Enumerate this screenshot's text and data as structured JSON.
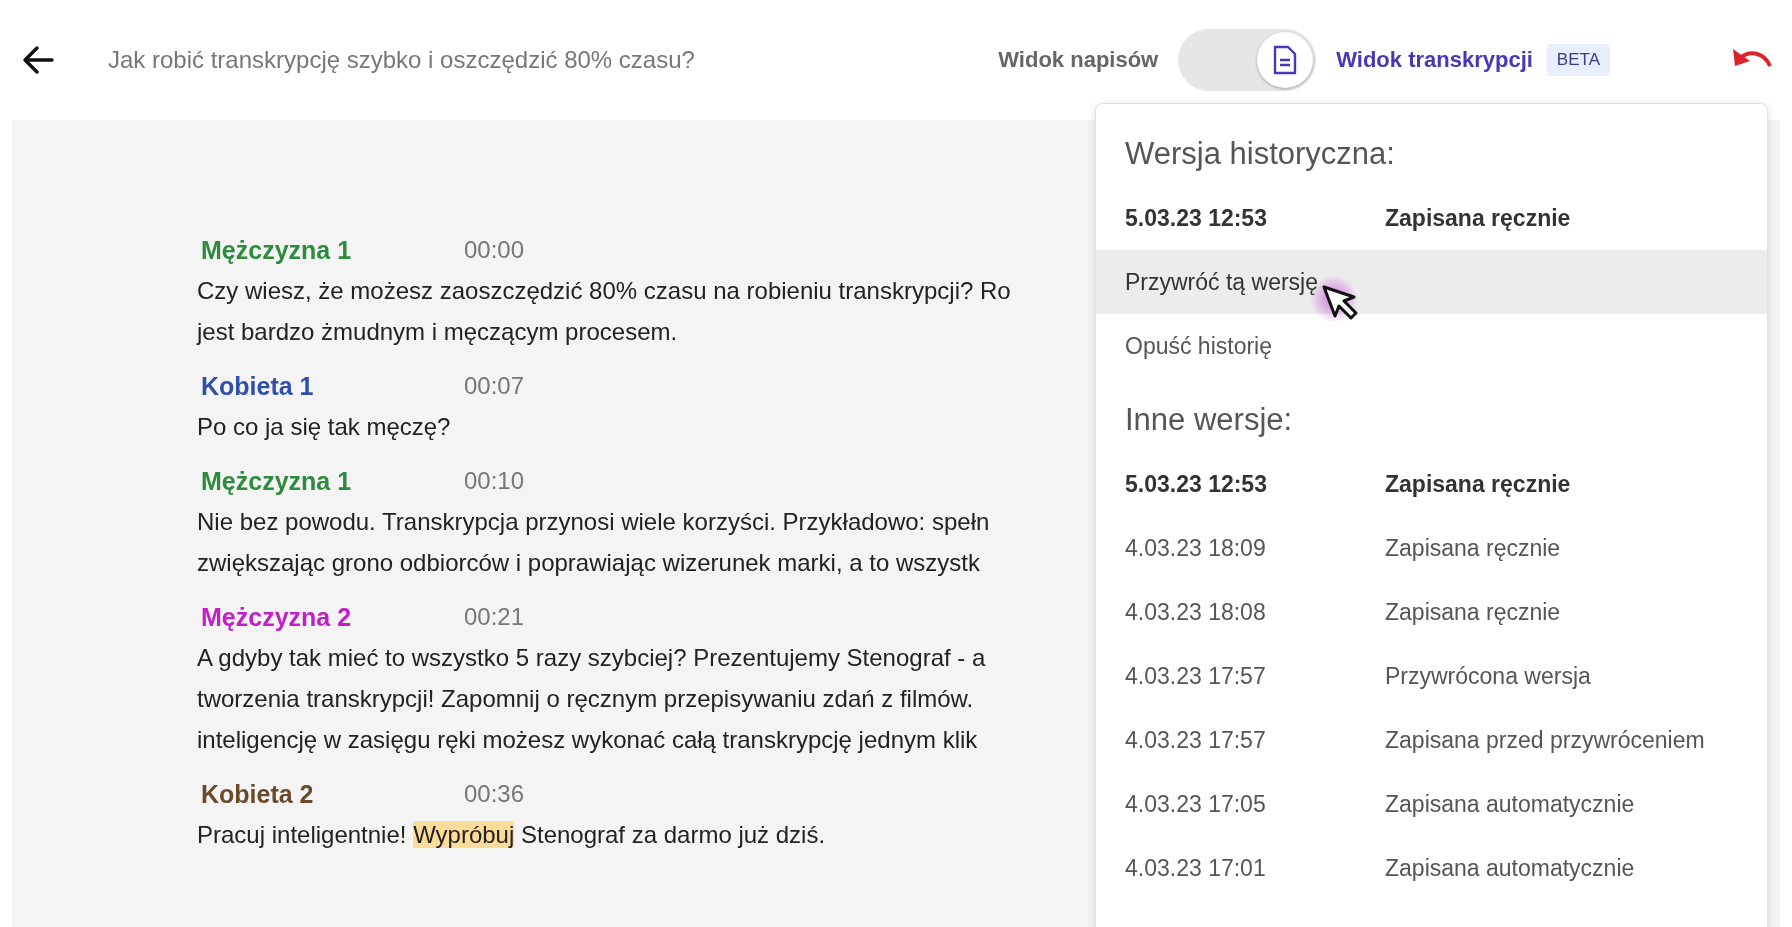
{
  "header": {
    "title": "Jak robić transkrypcję szybko i oszczędzić 80% czasu?",
    "view_toggle": {
      "left_label": "Widok napisów",
      "right_label": "Widok transkrypcji",
      "on": true,
      "badge": "BETA"
    }
  },
  "transcript": [
    {
      "speaker": "Mężczyzna 1",
      "color": "#2e8b3e",
      "time": "00:00",
      "lines": [
        [
          {
            "text": "Czy wiesz, że możesz zaoszczędzić 80% czasu na robieniu transkrypcji? Ro",
            "highlighted": false
          }
        ],
        [
          {
            "text": "jest bardzo żmudnym i męczącym procesem.",
            "highlighted": false
          }
        ]
      ]
    },
    {
      "speaker": "Kobieta 1",
      "color": "#2f4fa8",
      "time": "00:07",
      "lines": [
        [
          {
            "text": "Po co ja się tak męczę?",
            "highlighted": false
          }
        ]
      ]
    },
    {
      "speaker": "Mężczyzna 1",
      "color": "#2e8b3e",
      "time": "00:10",
      "lines": [
        [
          {
            "text": "Nie bez powodu. Transkrypcja przynosi wiele korzyści. Przykładowo: spełn",
            "highlighted": false
          }
        ],
        [
          {
            "text": "zwiększając grono odbiorców i poprawiając wizerunek marki, a to wszystk",
            "highlighted": false
          }
        ]
      ]
    },
    {
      "speaker": "Mężczyzna 2",
      "color": "#c21fc8",
      "time": "00:21",
      "lines": [
        [
          {
            "text": "A gdyby tak mieć to wszystko 5 razy szybciej? Prezentujemy Stenograf - a",
            "highlighted": false
          }
        ],
        [
          {
            "text": "tworzenia transkrypcji! Zapomnij o ręcznym przepisywaniu zdań z filmów.",
            "highlighted": false
          }
        ],
        [
          {
            "text": "inteligencję w zasięgu ręki możesz wykonać całą transkrypcję jednym klik",
            "highlighted": false
          }
        ]
      ]
    },
    {
      "speaker": "Kobieta 2",
      "color": "#6b4a2b",
      "time": "00:36",
      "lines": [
        [
          {
            "text": "Pracuj inteligentnie! ",
            "highlighted": false
          },
          {
            "text": "Wypróbuj",
            "highlighted": true
          },
          {
            "text": " Stenograf za darmo już dziś.",
            "highlighted": false
          }
        ]
      ]
    }
  ],
  "history_menu": {
    "historical_heading": "Wersja historyczna:",
    "historical_version": {
      "date": "5.03.23 12:53",
      "label": "Zapisana ręcznie"
    },
    "actions": [
      {
        "label": "Przywróć tą wersję",
        "selected": true
      },
      {
        "label": "Opuść historię",
        "selected": false
      }
    ],
    "other_heading": "Inne wersje:",
    "versions": [
      {
        "date": "5.03.23 12:53",
        "label": "Zapisana ręcznie",
        "selected": true
      },
      {
        "date": "4.03.23 18:09",
        "label": "Zapisana ręcznie",
        "selected": false
      },
      {
        "date": "4.03.23 18:08",
        "label": "Zapisana ręcznie",
        "selected": false
      },
      {
        "date": "4.03.23 17:57",
        "label": "Przywrócona wersja",
        "selected": false
      },
      {
        "date": "4.03.23 17:57",
        "label": "Zapisana przed przywróceniem",
        "selected": false
      },
      {
        "date": "4.03.23 17:05",
        "label": "Zapisana automatycznie",
        "selected": false
      },
      {
        "date": "4.03.23 17:01",
        "label": "Zapisana automatycznie",
        "selected": false
      }
    ]
  }
}
